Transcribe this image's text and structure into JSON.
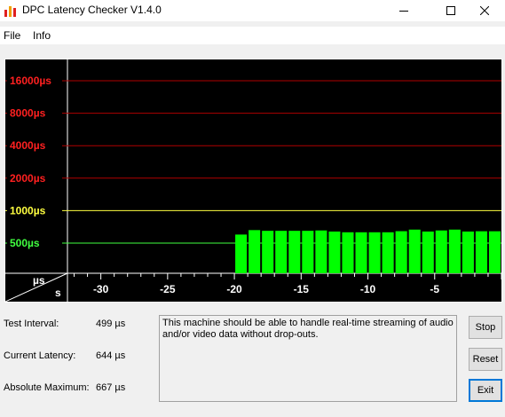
{
  "window": {
    "title": "DPC Latency Checker V1.4.0"
  },
  "menu": {
    "file": "File",
    "info": "Info"
  },
  "chart_data": {
    "type": "bar",
    "y_scale": "log",
    "y_ticks": [
      {
        "label": "16000µs",
        "value": 16000,
        "color": "#ff2020",
        "line": "#b00000"
      },
      {
        "label": "8000µs",
        "value": 8000,
        "color": "#ff2020",
        "line": "#b00000"
      },
      {
        "label": "4000µs",
        "value": 4000,
        "color": "#ff2020",
        "line": "#b00000"
      },
      {
        "label": "2000µs",
        "value": 2000,
        "color": "#ff2020",
        "line": "#b00000"
      },
      {
        "label": "1000µs",
        "value": 1000,
        "color": "#ffff40",
        "line": "#ffff40"
      },
      {
        "label": "500µs",
        "value": 500,
        "color": "#40ff40",
        "line": "#40ff40"
      }
    ],
    "ylabel": "µs",
    "xlabel": "s",
    "x_ticks": [
      -30,
      -25,
      -20,
      -15,
      -10,
      -5
    ],
    "xlim": [
      -32.5,
      0
    ],
    "bar_color": "#00ff00",
    "bars": [
      {
        "x": -19.5,
        "y": 600
      },
      {
        "x": -18.5,
        "y": 660
      },
      {
        "x": -17.5,
        "y": 650
      },
      {
        "x": -16.5,
        "y": 650
      },
      {
        "x": -15.5,
        "y": 650
      },
      {
        "x": -14.5,
        "y": 650
      },
      {
        "x": -13.5,
        "y": 655
      },
      {
        "x": -12.5,
        "y": 640
      },
      {
        "x": -11.5,
        "y": 630
      },
      {
        "x": -10.5,
        "y": 630
      },
      {
        "x": -9.5,
        "y": 630
      },
      {
        "x": -8.5,
        "y": 630
      },
      {
        "x": -7.5,
        "y": 645
      },
      {
        "x": -6.5,
        "y": 667
      },
      {
        "x": -5.5,
        "y": 640
      },
      {
        "x": -4.5,
        "y": 655
      },
      {
        "x": -3.5,
        "y": 667
      },
      {
        "x": -2.5,
        "y": 640
      },
      {
        "x": -1.5,
        "y": 644
      },
      {
        "x": -0.5,
        "y": 644
      }
    ]
  },
  "stats": {
    "test_interval_label": "Test Interval:",
    "test_interval_value": "499 µs",
    "current_latency_label": "Current Latency:",
    "current_latency_value": "644 µs",
    "absolute_maximum_label": "Absolute Maximum:",
    "absolute_maximum_value": "667 µs"
  },
  "message": "This machine should be able to handle real-time streaming of audio and/or video data without drop-outs.",
  "buttons": {
    "stop": "Stop",
    "reset": "Reset",
    "exit": "Exit"
  }
}
